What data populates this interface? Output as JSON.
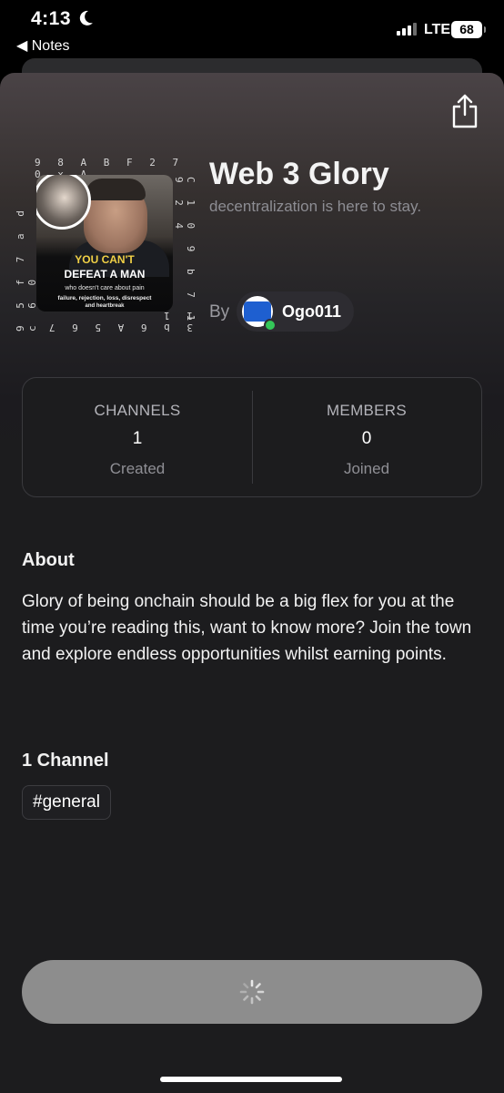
{
  "status_bar": {
    "time": "4:13",
    "back_label": "◀ Notes",
    "network": "LTE",
    "battery": "68"
  },
  "header": {
    "title": "Web 3 Glory",
    "subtitle": "decentralization is here to stay.",
    "by_label": "By",
    "owner_name": "Ogo011",
    "share_icon": "share-icon"
  },
  "artwork": {
    "ring_top": "9 8 A B F 2 7 0 x A",
    "ring_right": "C 1 0 9 b 7 1 9 2 4",
    "ring_bottom": "3 b 6 A 5 6 7 1 1",
    "ring_left": "9 5 f 7 a d c 6 0",
    "line1": "YOU CAN'T",
    "line2": "DEFEAT A MAN",
    "line3": "who doesn't care about pain",
    "line4": "failure, rejection, loss, disrespect",
    "line5": "and heartbreak"
  },
  "stats": [
    {
      "heading": "CHANNELS",
      "value": "1",
      "caption": "Created"
    },
    {
      "heading": "MEMBERS",
      "value": "0",
      "caption": "Joined"
    }
  ],
  "about": {
    "heading": "About",
    "text": "Glory of being onchain should be a big flex for you at the time you’re reading this, want to know more? Join the town and explore endless opportunities whilst earning points."
  },
  "channels": {
    "heading": "1 Channel",
    "items": [
      "#general"
    ]
  },
  "colors": {
    "background": "#1c1c1e",
    "online": "#34c759",
    "cta": "#8d8d8d"
  }
}
